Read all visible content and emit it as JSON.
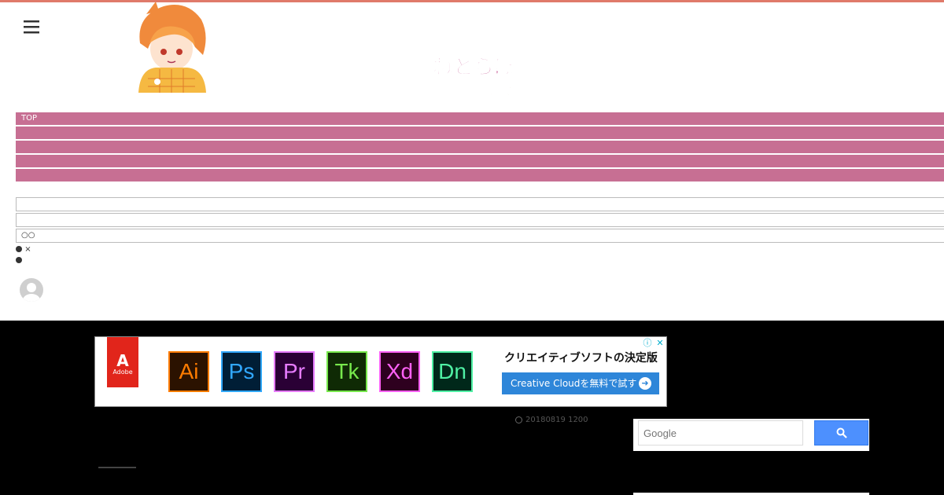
{
  "header": {
    "menu_icon": "hamburger-menu-icon",
    "logo_line1": "ねとらぼ",
    "logo_line2": "エンタ"
  },
  "nav": {
    "items": [
      "TOP",
      "",
      "",
      "",
      ""
    ]
  },
  "content": {
    "boxes": [
      "",
      "",
      "○○"
    ],
    "dot_line1_text": "×"
  },
  "ad": {
    "brand": "Adobe",
    "apps": [
      {
        "label": "Ai",
        "color": "#ff7c00",
        "bg": "#2b1200"
      },
      {
        "label": "Ps",
        "color": "#31a8ff",
        "bg": "#001e36"
      },
      {
        "label": "Pr",
        "color": "#e77cff",
        "bg": "#2a0035"
      },
      {
        "label": "Tk",
        "color": "#77e84c",
        "bg": "#0f2a05"
      },
      {
        "label": "Xd",
        "color": "#ff61f6",
        "bg": "#2e001f"
      },
      {
        "label": "Dn",
        "color": "#4ff0a4",
        "bg": "#00281a"
      }
    ],
    "headline": "クリエイティブソフトの決定版",
    "cta": "Creative Cloudを無料で試す",
    "info_icon": "ⓘ",
    "close_icon": "✕"
  },
  "post": {
    "timestamp": "20180819 1200"
  },
  "search": {
    "placeholder": "Google",
    "button_icon": "search-icon"
  },
  "colors": {
    "nav_bg": "#c76f93",
    "top_accent": "#e07a6a",
    "search_button": "#4d90fe",
    "cta_bg": "#2e86d9"
  }
}
